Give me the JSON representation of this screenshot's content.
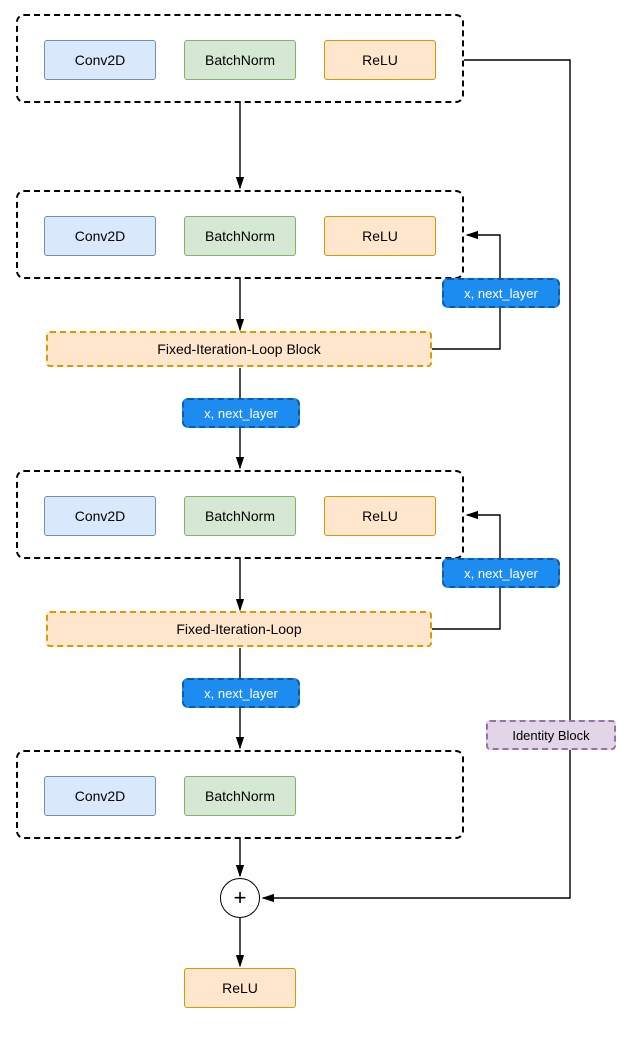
{
  "labels": {
    "conv": "Conv2D",
    "bn": "BatchNorm",
    "relu": "ReLU",
    "loop1": "Fixed-Iteration-Loop Block",
    "loop2": "Fixed-Iteration-Loop",
    "tag": "x, next_layer",
    "identity": "Identity Block",
    "plus": "+"
  },
  "diagram": {
    "nodes": [
      {
        "id": "g1",
        "type": "group",
        "contains": [
          "conv",
          "bn",
          "relu"
        ]
      },
      {
        "id": "g2",
        "type": "group",
        "contains": [
          "conv",
          "bn",
          "relu"
        ]
      },
      {
        "id": "l1",
        "type": "loop",
        "label": "Fixed-Iteration-Loop Block"
      },
      {
        "id": "g3",
        "type": "group",
        "contains": [
          "conv",
          "bn",
          "relu"
        ]
      },
      {
        "id": "l2",
        "type": "loop",
        "label": "Fixed-Iteration-Loop"
      },
      {
        "id": "g4",
        "type": "group",
        "contains": [
          "conv",
          "bn"
        ]
      },
      {
        "id": "add",
        "type": "add"
      },
      {
        "id": "r",
        "type": "relu"
      },
      {
        "id": "id",
        "type": "identity-block"
      }
    ],
    "edges": [
      {
        "from": "g1",
        "to": "g2"
      },
      {
        "from": "g2",
        "to": "l1"
      },
      {
        "from": "l1",
        "to": "g2",
        "label": "x, next_layer",
        "kind": "loop-back"
      },
      {
        "from": "l1",
        "to": "g3",
        "label": "x, next_layer"
      },
      {
        "from": "g3",
        "to": "l2"
      },
      {
        "from": "l2",
        "to": "g3",
        "label": "x, next_layer",
        "kind": "loop-back"
      },
      {
        "from": "l2",
        "to": "g4",
        "label": "x, next_layer"
      },
      {
        "from": "g4",
        "to": "add"
      },
      {
        "from": "g1",
        "to": "add",
        "kind": "identity"
      },
      {
        "from": "add",
        "to": "r"
      }
    ]
  }
}
